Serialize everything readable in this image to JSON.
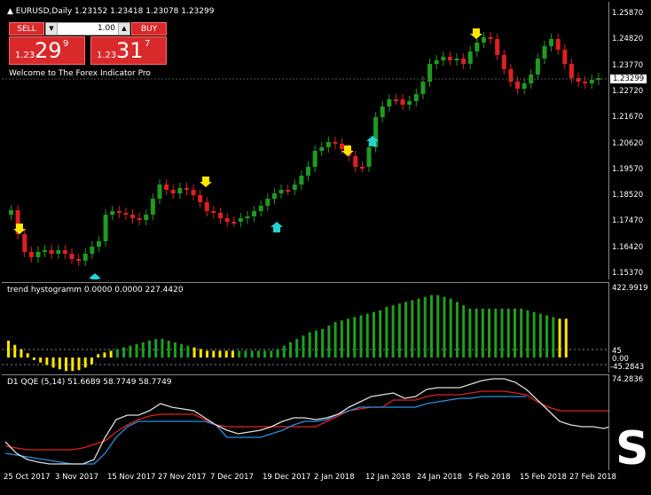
{
  "header": {
    "symbol_line": "▲ EURUSD,Daily  1.23152 1.23418 1.23078 1.23299"
  },
  "trade": {
    "sell_label": "SELL",
    "buy_label": "BUY",
    "lot": "1.00",
    "sell_small": "1.23",
    "sell_big": "29",
    "sell_sup": "9",
    "buy_small": "1.23",
    "buy_big": "31",
    "buy_sup": "7",
    "welcome": "Welcome to The Forex Indicator Pro"
  },
  "price_axis": [
    "1.25870",
    "1.24820",
    "1.23770",
    "1.22720",
    "1.21670",
    "1.20620",
    "1.19570",
    "1.18520",
    "1.17470",
    "1.16420",
    "1.15370"
  ],
  "current_price": "1.23299",
  "hist_panel": {
    "title": "trend hystogramm 0.0000 0.0000 227.4420",
    "top_label": "422.9919",
    "l45": "45",
    "l0": "0.00",
    "lm": "-45.2843"
  },
  "qqe_panel": {
    "title": "D1  QQE (5,14) 51.6689 58.7749 58.7749",
    "top_label": "74.2836"
  },
  "date_axis": [
    "25 Oct 2017",
    "3 Nov 2017",
    "15 Nov 2017",
    "27 Nov 2017",
    "7 Dec 2017",
    "19 Dec 2017",
    "2 Jan 2018",
    "12 Jan 2018",
    "24 Jan 2018",
    "5 Feb 2018",
    "15 Feb 2018",
    "27 Feb 2018"
  ],
  "colors": {
    "bull": "#1e9c1e",
    "bear": "#e02020",
    "arrow_up": "#22d3d3",
    "arrow_down": "#ffe600",
    "hist_green": "#1f9f1f",
    "hist_yellow": "#ffe600"
  },
  "big_glyph": "S"
}
